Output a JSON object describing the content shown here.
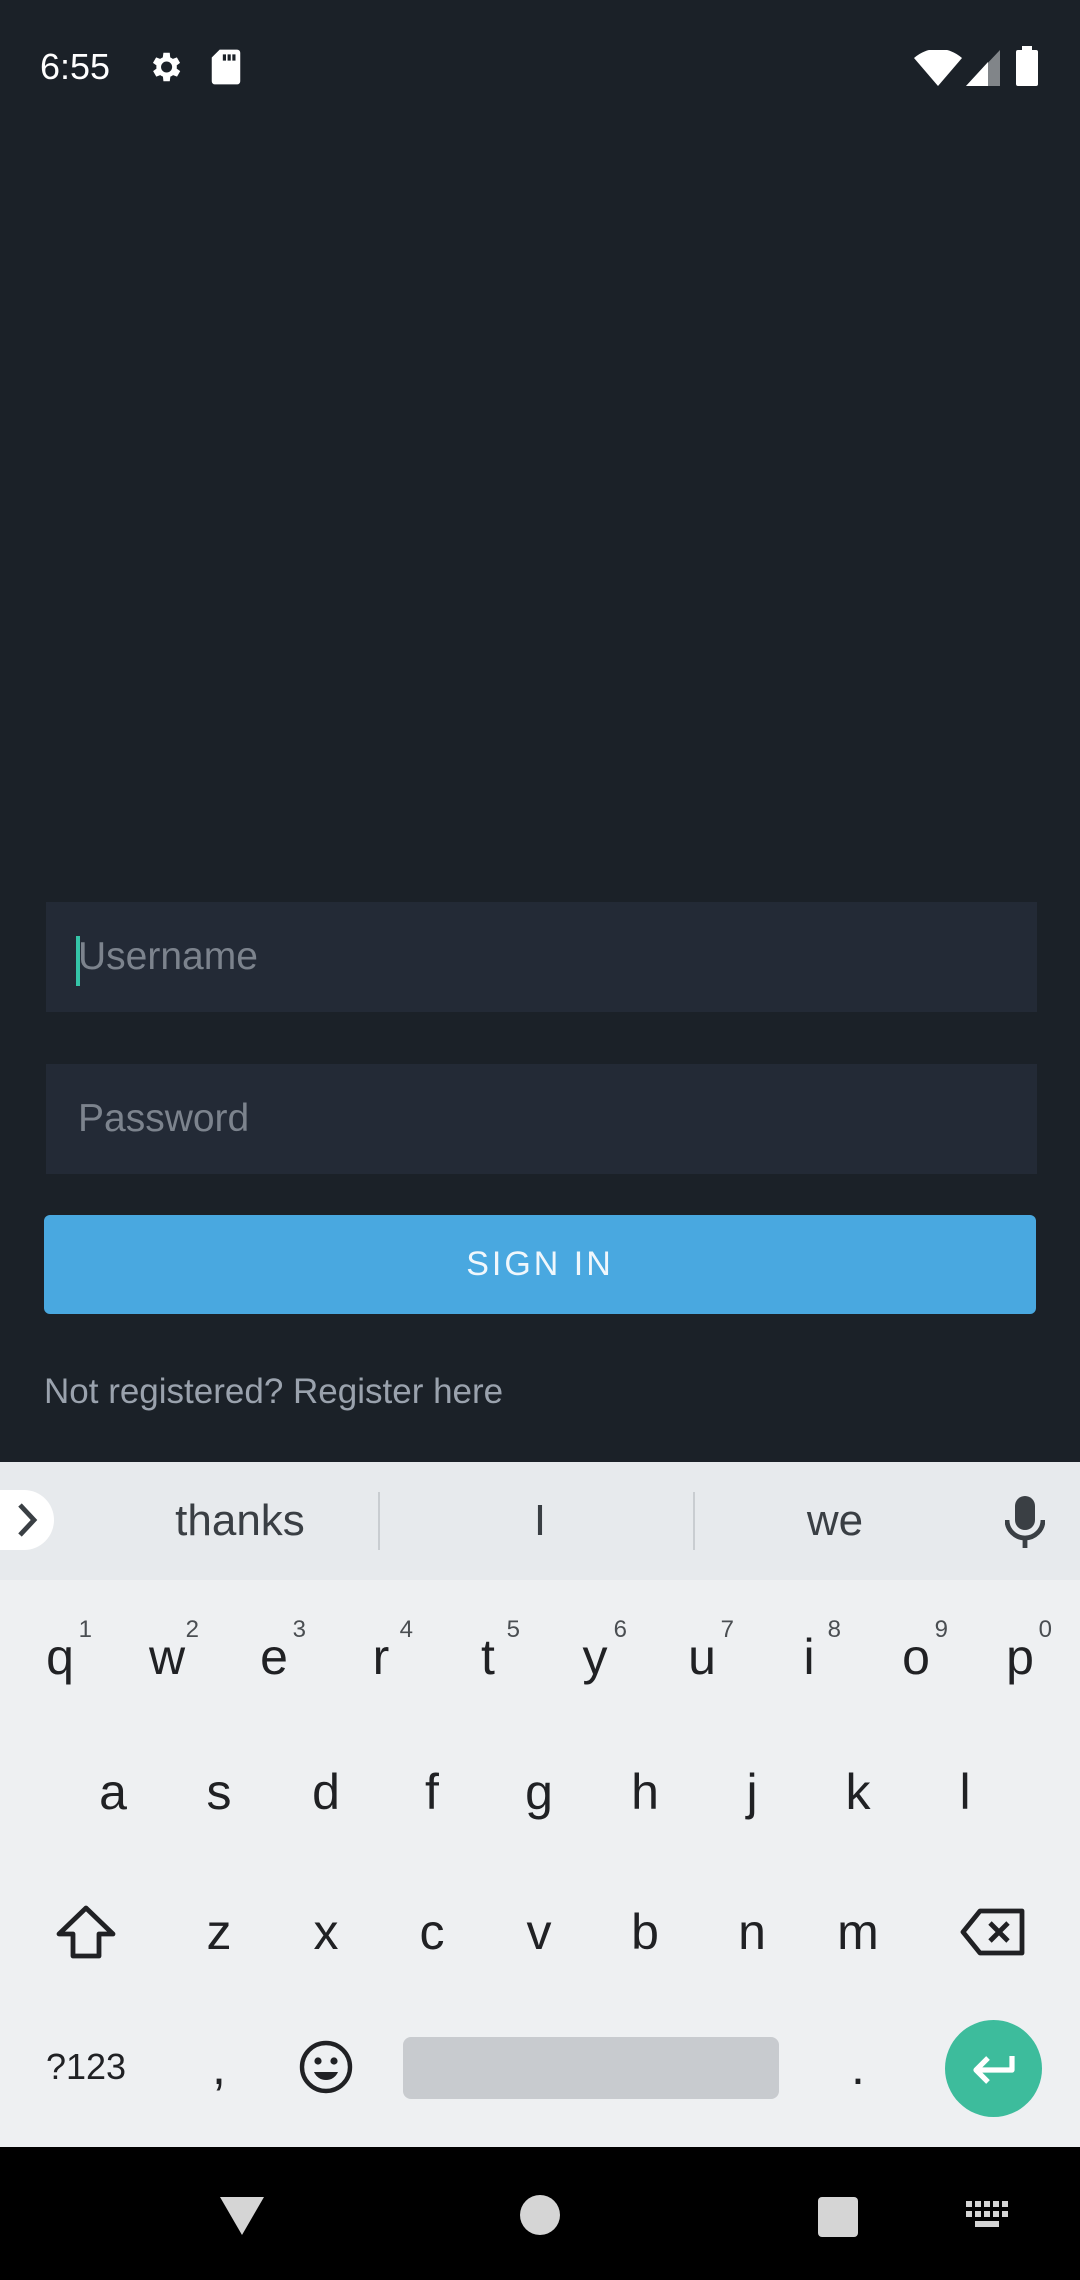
{
  "status_bar": {
    "time": "6:55",
    "icons": [
      "gear-icon",
      "sd-card-icon",
      "wifi-icon",
      "signal-icon",
      "battery-icon"
    ]
  },
  "login": {
    "username_placeholder": "Username",
    "password_placeholder": "Password",
    "signin_label": "SIGN IN",
    "register_text": "Not registered? Register here"
  },
  "keyboard": {
    "suggestions": [
      "thanks",
      "I",
      "we"
    ],
    "row1": [
      {
        "key": "q",
        "hint": "1"
      },
      {
        "key": "w",
        "hint": "2"
      },
      {
        "key": "e",
        "hint": "3"
      },
      {
        "key": "r",
        "hint": "4"
      },
      {
        "key": "t",
        "hint": "5"
      },
      {
        "key": "y",
        "hint": "6"
      },
      {
        "key": "u",
        "hint": "7"
      },
      {
        "key": "i",
        "hint": "8"
      },
      {
        "key": "o",
        "hint": "9"
      },
      {
        "key": "p",
        "hint": "0"
      }
    ],
    "row2": [
      "a",
      "s",
      "d",
      "f",
      "g",
      "h",
      "j",
      "k",
      "l"
    ],
    "row3": [
      "z",
      "x",
      "c",
      "v",
      "b",
      "n",
      "m"
    ],
    "symbols_label": "?123",
    "comma": ",",
    "period": "."
  },
  "colors": {
    "background": "#1b2128",
    "field": "#232a36",
    "signin": "#49a8e0",
    "accent": "#3dbc9c"
  }
}
